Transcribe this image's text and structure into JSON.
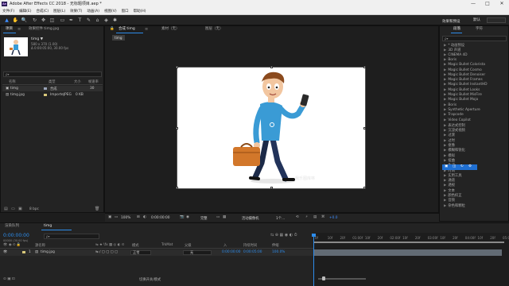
{
  "window": {
    "logo": "Ae",
    "title": "Adobe After Effects CC 2018 - 无标题项目.aep *",
    "buttons": [
      "—",
      "□",
      "✕"
    ]
  },
  "menu": [
    "文件(F)",
    "编辑(E)",
    "合成(C)",
    "图层(L)",
    "效果(T)",
    "动画(A)",
    "视图(V)",
    "窗口",
    "帮助(H)"
  ],
  "toolbar": {
    "workspace": "默认",
    "tool_glyphs": [
      "▲",
      "✋",
      "🔍",
      "↻",
      "✥",
      "◫",
      "▭",
      "✒",
      "T",
      "✎",
      "⌂",
      "◈",
      "✱"
    ]
  },
  "project": {
    "tab": "项目",
    "menu_glyph": "≡",
    "fx_tab": "效果控件 timg.jpg",
    "item_name": "timg ▼",
    "item_info1": "580 x 370 (1.00)",
    "item_info2": "Δ 0:00:05:00, 30.00 fps",
    "search_placeholder": "ρ▾",
    "columns": {
      "name": "名称",
      "type": "类型",
      "size": "大小",
      "rate": "帧速率"
    },
    "rows": [
      {
        "name": "timg",
        "type": "合成",
        "size": "",
        "rate": "30",
        "color": "#9aa4b8"
      },
      {
        "name": "timg.jpg",
        "type": "ImporteJPEG",
        "size": "0 KB",
        "rate": "",
        "color": "#d8c87a"
      }
    ],
    "bpc": "8 bpc"
  },
  "composition": {
    "tabs": [
      "合成 timg",
      "素材（无）",
      "图层（无）"
    ],
    "flow_tab": "timg",
    "zoom": "100%",
    "timecode": "0:00:00:00",
    "resolution": "完整",
    "camera": "活动摄像机",
    "views": "1个…",
    "offset": "+0.0"
  },
  "right_panel": {
    "tabs": [
      "段落",
      "字符"
    ],
    "effects_tab": "效果和预设",
    "search_placeholder": "ρ▾",
    "items": [
      "* 动画预设",
      "3D 声道",
      "CINEMA 4D",
      "Boris",
      "Magic Bullet Colorista",
      "Magic Bullet Cosmo",
      "Magic Bullet Denoiser",
      "Magic Bullet Frames",
      "Magic Bullet InstantHD",
      "Magic Bullet Looks",
      "Magic Bullet MisFire",
      "Magic Bullet Mojo",
      "Knoll",
      "Synthetic Aperture",
      "Trapcode",
      "Video Copilot",
      "表达式控制",
      "沉浸式视频",
      "风格化",
      "过渡",
      "过时",
      "抠像",
      "模糊和锐化",
      "模拟",
      "扭曲",
      "生成",
      "时间",
      "实用工具",
      "通道",
      "透视",
      "文本",
      "颜色校正",
      "音频",
      "杂色和颗粒",
      "遮罩"
    ],
    "visible_items": [
      "* 动画预设",
      "3D 声道",
      "CINEMA 4D",
      "Boris",
      "Magic Bullet Colorista",
      "Magic Bullet Cosmo",
      "Magic Bullet Denoiser",
      "Magic Bullet Frames",
      "Magic Bullet InstantHD",
      "Magic Bullet Looks",
      "Magic Bullet MisFire",
      "Magic Bullet Mojo",
      "Boris",
      "Synthetic Aperture",
      "Trapcode",
      "Video Copilot",
      "表达式控制",
      "沉浸式视频",
      "过渡",
      "过时",
      "抠像",
      "模糊和锐化",
      "模拟",
      "扭曲",
      "生成",
      "时间",
      "实用工具",
      "通道",
      "透视",
      "文本",
      "颜色校正",
      "音频",
      "杂色和颗粒"
    ]
  },
  "timeline": {
    "tabs": [
      "渲染队列",
      "timg"
    ],
    "timecode": "0:00:00:00",
    "fps_info": "00000 (30.00 fps)",
    "search_placeholder": "ρ▾",
    "ruler": [
      "0f",
      "10f",
      "20f",
      "01:00f",
      "10f",
      "20f",
      "02:00f",
      "10f",
      "20f",
      "03:00f",
      "10f",
      "20f",
      "04:00f",
      "10f",
      "20f",
      "05:0"
    ],
    "columns": {
      "source": "源名称",
      "mode": "模式",
      "trkmat": "TrkMat",
      "parent": "父级",
      "in": "入",
      "duration": "持续时间",
      "stretch": "伸缩"
    },
    "layer": {
      "index": "1",
      "name": "timg.jpg",
      "mode": "正常",
      "parent": "无",
      "in": "0:00:00:00",
      "duration": "0:00:05:00",
      "stretch": "100.0%"
    },
    "footer": "切换开关/模式"
  },
  "colors": {
    "accent": "#2d8ceb",
    "panel": "#232323",
    "background": "#1d1d1d"
  },
  "watermark": "我乐图库林"
}
